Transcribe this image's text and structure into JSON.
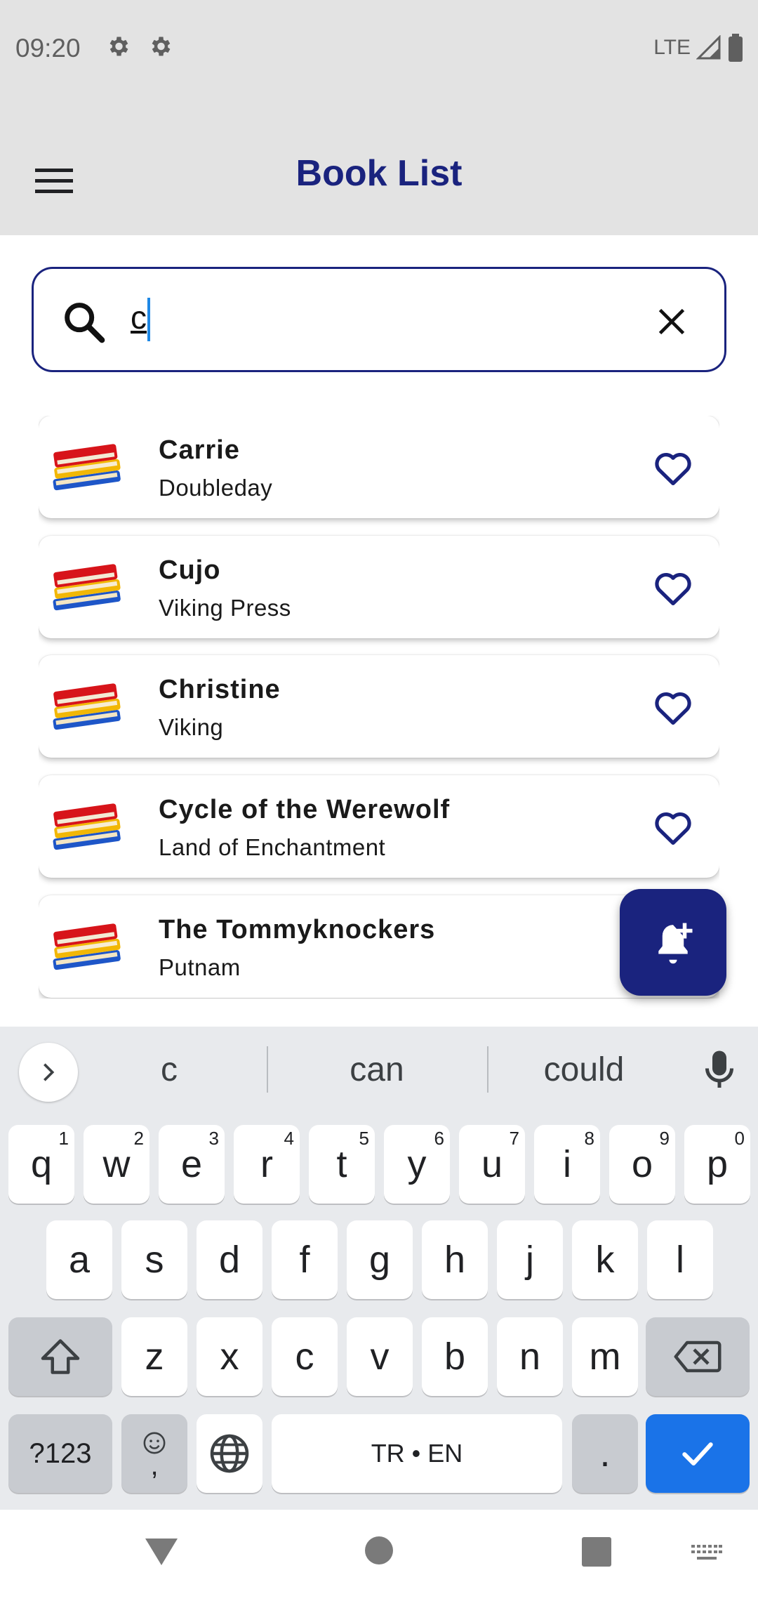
{
  "status": {
    "time": "09:20",
    "network": "LTE"
  },
  "appbar": {
    "title": "Book List"
  },
  "search": {
    "value": "c",
    "placeholder": ""
  },
  "books": [
    {
      "title": "Carrie",
      "publisher": "Doubleday"
    },
    {
      "title": "Cujo",
      "publisher": "Viking Press"
    },
    {
      "title": "Christine",
      "publisher": "Viking"
    },
    {
      "title": "Cycle of the Werewolf",
      "publisher": "Land of Enchantment"
    },
    {
      "title": "The Tommyknockers",
      "publisher": "Putnam"
    }
  ],
  "keyboard": {
    "suggestions": [
      "c",
      "can",
      "could"
    ],
    "row1": [
      {
        "label": "q",
        "hint": "1"
      },
      {
        "label": "w",
        "hint": "2"
      },
      {
        "label": "e",
        "hint": "3"
      },
      {
        "label": "r",
        "hint": "4"
      },
      {
        "label": "t",
        "hint": "5"
      },
      {
        "label": "y",
        "hint": "6"
      },
      {
        "label": "u",
        "hint": "7"
      },
      {
        "label": "i",
        "hint": "8"
      },
      {
        "label": "o",
        "hint": "9"
      },
      {
        "label": "p",
        "hint": "0"
      }
    ],
    "row2": [
      "a",
      "s",
      "d",
      "f",
      "g",
      "h",
      "j",
      "k",
      "l"
    ],
    "row3": [
      "z",
      "x",
      "c",
      "v",
      "b",
      "n",
      "m"
    ],
    "symbols_label": "?123",
    "comma_label": ",",
    "space_label": "TR • EN",
    "period_label": "."
  },
  "colors": {
    "accent": "#1a237e",
    "keyboard_bg": "#e8eaed",
    "enter": "#1a73e8"
  }
}
